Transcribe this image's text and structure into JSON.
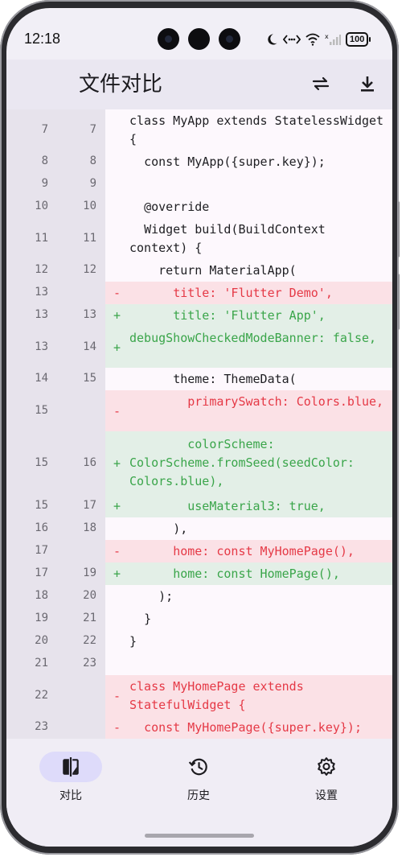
{
  "status": {
    "time": "12:18",
    "battery": "100"
  },
  "appbar": {
    "title": "文件对比",
    "swap_icon": "swap-icon",
    "download_icon": "download-icon"
  },
  "diff": {
    "lines": [
      {
        "old": "7",
        "new": "7",
        "type": "same",
        "text": "class MyApp extends StatelessWidget {"
      },
      {
        "old": "8",
        "new": "8",
        "type": "same",
        "text": "  const MyApp({super.key});"
      },
      {
        "old": "9",
        "new": "9",
        "type": "same",
        "text": ""
      },
      {
        "old": "10",
        "new": "10",
        "type": "same",
        "text": "  @override"
      },
      {
        "old": "11",
        "new": "11",
        "type": "same",
        "text": "  Widget build(BuildContext context) {"
      },
      {
        "old": "12",
        "new": "12",
        "type": "same",
        "text": "    return MaterialApp("
      },
      {
        "old": "13",
        "new": "",
        "type": "del",
        "text": "      title: 'Flutter Demo',"
      },
      {
        "old": "13",
        "new": "13",
        "type": "add",
        "text": "      title: 'Flutter App',"
      },
      {
        "old": "13",
        "new": "14",
        "type": "add",
        "text": "debugShowCheckedModeBanner: false,"
      },
      {
        "old": "14",
        "new": "15",
        "type": "same",
        "text": "      theme: ThemeData("
      },
      {
        "old": "15",
        "new": "",
        "type": "del",
        "text": "        primarySwatch: Colors.blue,"
      },
      {
        "old": "15",
        "new": "16",
        "type": "add",
        "text": "        colorScheme: ColorScheme.fromSeed(seedColor: Colors.blue),"
      },
      {
        "old": "15",
        "new": "17",
        "type": "add",
        "text": "        useMaterial3: true,"
      },
      {
        "old": "16",
        "new": "18",
        "type": "same",
        "text": "      ),"
      },
      {
        "old": "17",
        "new": "",
        "type": "del",
        "text": "      home: const MyHomePage(),"
      },
      {
        "old": "17",
        "new": "19",
        "type": "add",
        "text": "      home: const HomePage(),"
      },
      {
        "old": "18",
        "new": "20",
        "type": "same",
        "text": "    );"
      },
      {
        "old": "19",
        "new": "21",
        "type": "same",
        "text": "  }"
      },
      {
        "old": "20",
        "new": "22",
        "type": "same",
        "text": "}"
      },
      {
        "old": "21",
        "new": "23",
        "type": "same",
        "text": ""
      },
      {
        "old": "22",
        "new": "",
        "type": "del",
        "text": "class MyHomePage extends StatefulWidget {"
      },
      {
        "old": "23",
        "new": "",
        "type": "del",
        "text": "  const MyHomePage({super.key});"
      }
    ]
  },
  "nav": {
    "items": [
      {
        "label": "对比",
        "icon": "compare-icon",
        "active": true
      },
      {
        "label": "历史",
        "icon": "history-icon",
        "active": false
      },
      {
        "label": "设置",
        "icon": "settings-icon",
        "active": false
      }
    ]
  },
  "colors": {
    "del_bg": "#fbe1e6",
    "del_fg": "#e53946",
    "add_bg": "#e3efe7",
    "add_fg": "#3aa54a",
    "active_pill": "#dedbfa"
  }
}
